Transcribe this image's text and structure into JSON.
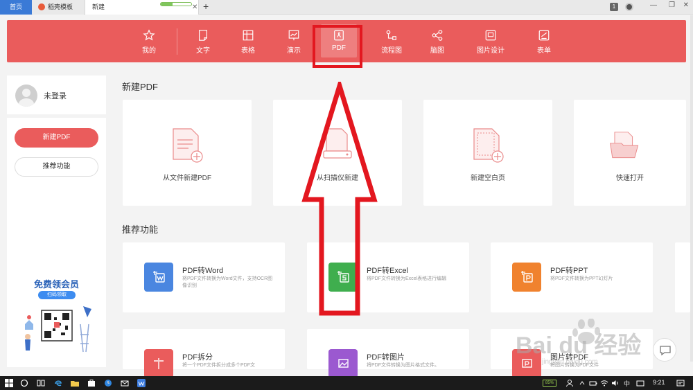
{
  "tabs": {
    "home": "首页",
    "templates": "稻壳模板",
    "new": "新建",
    "new_progress": 0.38,
    "close": "✕",
    "add": "+"
  },
  "window": {
    "badge": "1",
    "minimize": "—",
    "restore": "❐",
    "close": "✕"
  },
  "nav": {
    "items": [
      {
        "label": "我的",
        "icon": "star-icon"
      },
      {
        "label": "文字",
        "icon": "document-icon"
      },
      {
        "label": "表格",
        "icon": "table-icon"
      },
      {
        "label": "演示",
        "icon": "presentation-icon"
      },
      {
        "label": "PDF",
        "icon": "pdf-icon"
      },
      {
        "label": "流程图",
        "icon": "flowchart-icon"
      },
      {
        "label": "脑图",
        "icon": "mindmap-icon"
      },
      {
        "label": "图片设计",
        "icon": "image-design-icon"
      },
      {
        "label": "表单",
        "icon": "form-icon"
      }
    ],
    "active_index": 4
  },
  "sidebar": {
    "user_name": "未登录",
    "btn_new_pdf": "新建PDF",
    "btn_recommend": "推荐功能",
    "promo_title": "免费领会员",
    "promo_pill": "扫码领取"
  },
  "main": {
    "new_pdf_title": "新建PDF",
    "new_cards": [
      {
        "label": "从文件新建PDF"
      },
      {
        "label": "从扫描仪新建"
      },
      {
        "label": "新建空白页"
      },
      {
        "label": "快速打开"
      }
    ],
    "recommend_title": "推荐功能",
    "features": [
      {
        "title": "PDF转Word",
        "desc": "将PDF文件转换为Word文件，支持OCR图像识别",
        "color": "#4a86e0"
      },
      {
        "title": "PDF转Excel",
        "desc": "将PDF文件转换为Excel表格进行编辑",
        "color": "#3fae4e"
      },
      {
        "title": "PDF转PPT",
        "desc": "将PDF文件转换为PPT幻灯片",
        "color": "#f0822e"
      },
      {
        "title": "PDF拆分",
        "desc": "将一个PDF文件拆分成多个PDF文",
        "color": "#ea5c5c"
      },
      {
        "title": "PDF转图片",
        "desc": "将PDF文件转换为图片格式文件。",
        "color": "#9b59d0"
      },
      {
        "title": "图片转PDF",
        "desc": "将图片转换为PDF文件",
        "color": "#ea5c5c"
      }
    ]
  },
  "taskbar": {
    "battery": "85%",
    "ime": "中",
    "time": "9:21"
  },
  "watermark": {
    "text": "Bai du 经验",
    "sub": "jingyan.baidu.com"
  },
  "colors": {
    "accent": "#ea5c5c",
    "highlight": "#e3171f",
    "home_tab": "#3a7ad6"
  }
}
